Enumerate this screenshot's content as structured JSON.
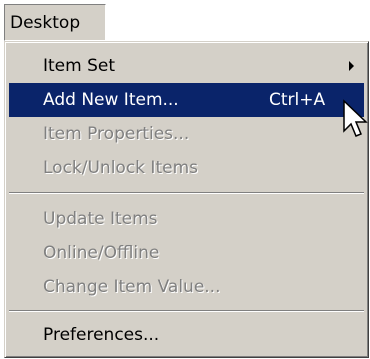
{
  "menubar": {
    "title": "Desktop"
  },
  "menu": {
    "items": [
      {
        "label": "Item Set",
        "state": "enabled",
        "submenu": true
      },
      {
        "label": "Add New Item...",
        "shortcut": "Ctrl+A",
        "state": "highlighted"
      },
      {
        "label": "Item Properties...",
        "state": "disabled"
      },
      {
        "label": "Lock/Unlock Items",
        "state": "disabled"
      },
      {
        "label": "Update Items",
        "state": "disabled"
      },
      {
        "label": "Online/Offline",
        "state": "disabled"
      },
      {
        "label": "Change Item Value...",
        "state": "disabled"
      },
      {
        "label": "Preferences...",
        "state": "enabled"
      }
    ]
  },
  "colors": {
    "menu_bg": "#d4d0c8",
    "highlight_bg": "#0a246a",
    "highlight_text": "#ffffff",
    "disabled_text": "#808080"
  },
  "icons": {
    "cursor": "arrow-cursor-icon",
    "submenu": "submenu-arrow-icon"
  }
}
